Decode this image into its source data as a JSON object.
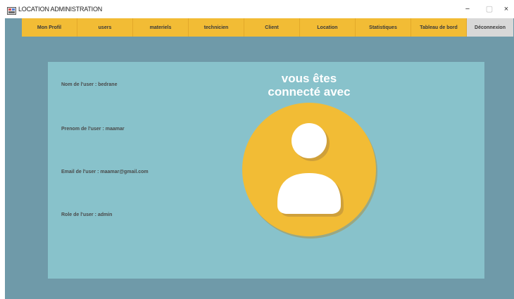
{
  "window": {
    "title": "LOCATION ADMINISTRATION",
    "controls": {
      "minimize": "−",
      "maximize": "▢",
      "close": "×"
    }
  },
  "menu": {
    "items": [
      {
        "label": "Mon Profil"
      },
      {
        "label": "users"
      },
      {
        "label": "materiels"
      },
      {
        "label": "technicien"
      },
      {
        "label": "Client"
      },
      {
        "label": "Location"
      },
      {
        "label": "Statistiques"
      },
      {
        "label": "Tableau de bord"
      },
      {
        "label": "Déconnexion"
      }
    ]
  },
  "profile": {
    "nom": "Nom de l'user : bedrane",
    "prenom": "Prenom de l'user : maamar",
    "email": "Email de l'user : maamar@gmail.com",
    "role": "Role de l'user : admin"
  },
  "headline": {
    "line1": "vous êtes",
    "line2": "connecté avec"
  },
  "colors": {
    "frame_background": "#6f9aa9",
    "panel_background": "#88c2cb",
    "menu_accent": "#f2bc35",
    "avatar_circle": "#f2bc35",
    "avatar_icon": "#ffffff"
  },
  "icons": {
    "app": "java-app-icon",
    "avatar": "user-avatar-icon"
  }
}
